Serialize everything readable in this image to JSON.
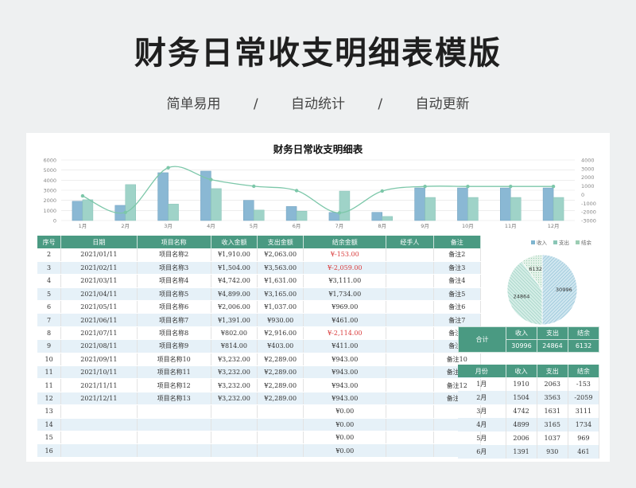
{
  "header": {
    "title": "财务日常收支明细表模版",
    "tags": [
      "简单易用",
      "/",
      "自动统计",
      "/",
      "自动更新"
    ]
  },
  "sheet_title": "财务日常收支明细表",
  "colors": {
    "primary": "#4a9a82",
    "income": "#8ab8d4",
    "expense": "#9fd3c8",
    "balance": "#7cc7a9",
    "row_alt": "#e6f1f8",
    "negative": "#d93b3b"
  },
  "chart_data": {
    "type": "bar",
    "categories": [
      "1月",
      "2月",
      "3月",
      "4月",
      "5月",
      "6月",
      "7月",
      "8月",
      "9月",
      "10月",
      "11月",
      "12月"
    ],
    "series": [
      {
        "name": "收入",
        "values": [
          1910,
          1504,
          4742,
          4899,
          2006,
          1391,
          802,
          814,
          3232,
          3232,
          3232,
          3232
        ]
      },
      {
        "name": "支出",
        "values": [
          2063,
          3563,
          1631,
          3165,
          1037,
          930,
          2916,
          403,
          2289,
          2289,
          2289,
          2289
        ]
      },
      {
        "name": "结余",
        "type": "line",
        "values": [
          -153,
          -2059,
          3111,
          1734,
          969,
          461,
          -2114,
          411,
          943,
          943,
          943,
          943
        ]
      }
    ],
    "y_left": {
      "min": 0,
      "max": 6000,
      "ticks": [
        "0",
        "1000",
        "2000",
        "3000",
        "4000",
        "5000",
        "6000"
      ]
    },
    "y_right": {
      "min": -3000,
      "max": 4000,
      "ticks": [
        "-3000",
        "-2000",
        "-1000",
        "0",
        "1000",
        "2000",
        "3000",
        "4000"
      ]
    },
    "grid": true
  },
  "table": {
    "columns": [
      "序号",
      "日期",
      "项目名称",
      "收入金额",
      "支出金额",
      "结余金额",
      "经手人",
      "备注"
    ],
    "rows": [
      [
        "2",
        "2021/01/11",
        "项目名称2",
        "¥1,910.00",
        "¥2,063.00",
        "¥-153.00",
        "",
        "备注2"
      ],
      [
        "3",
        "2021/02/11",
        "项目名称3",
        "¥1,504.00",
        "¥3,563.00",
        "¥-2,059.00",
        "",
        "备注3"
      ],
      [
        "4",
        "2021/03/11",
        "项目名称4",
        "¥4,742.00",
        "¥1,631.00",
        "¥3,111.00",
        "",
        "备注4"
      ],
      [
        "5",
        "2021/04/11",
        "项目名称5",
        "¥4,899.00",
        "¥3,165.00",
        "¥1,734.00",
        "",
        "备注5"
      ],
      [
        "6",
        "2021/05/11",
        "项目名称6",
        "¥2,006.00",
        "¥1,037.00",
        "¥969.00",
        "",
        "备注6"
      ],
      [
        "7",
        "2021/06/11",
        "项目名称7",
        "¥1,391.00",
        "¥930.00",
        "¥461.00",
        "",
        "备注7"
      ],
      [
        "8",
        "2021/07/11",
        "项目名称8",
        "¥802.00",
        "¥2,916.00",
        "¥-2,114.00",
        "",
        "备注8"
      ],
      [
        "9",
        "2021/08/11",
        "项目名称9",
        "¥814.00",
        "¥403.00",
        "¥411.00",
        "",
        "备注9"
      ],
      [
        "10",
        "2021/09/11",
        "项目名称10",
        "¥3,232.00",
        "¥2,289.00",
        "¥943.00",
        "",
        "备注10"
      ],
      [
        "11",
        "2021/10/11",
        "项目名称11",
        "¥3,232.00",
        "¥2,289.00",
        "¥943.00",
        "",
        "备注11"
      ],
      [
        "11",
        "2021/11/11",
        "项目名称12",
        "¥3,232.00",
        "¥2,289.00",
        "¥943.00",
        "",
        "备注12"
      ],
      [
        "12",
        "2021/12/11",
        "项目名称13",
        "¥3,232.00",
        "¥2,289.00",
        "¥943.00",
        "",
        "备注13"
      ],
      [
        "13",
        "",
        "",
        "",
        "",
        "¥0.00",
        "",
        ""
      ],
      [
        "14",
        "",
        "",
        "",
        "",
        "¥0.00",
        "",
        ""
      ],
      [
        "15",
        "",
        "",
        "",
        "",
        "¥0.00",
        "",
        ""
      ],
      [
        "16",
        "",
        "",
        "",
        "",
        "¥0.00",
        "",
        ""
      ]
    ]
  },
  "pie": {
    "legend": [
      "收入",
      "支出",
      "结余"
    ],
    "values": [
      30996,
      24864,
      6132
    ],
    "labels": [
      "30996",
      "24864",
      "6132"
    ]
  },
  "summary": {
    "label": "合计",
    "headers": [
      "收入",
      "支出",
      "结余"
    ],
    "values": [
      "30996",
      "24864",
      "6132"
    ]
  },
  "monthly": {
    "headers": [
      "月份",
      "收入",
      "支出",
      "结余"
    ],
    "rows": [
      [
        "1月",
        "1910",
        "2063",
        "-153"
      ],
      [
        "2月",
        "1504",
        "3563",
        "-2059"
      ],
      [
        "3月",
        "4742",
        "1631",
        "3111"
      ],
      [
        "4月",
        "4899",
        "3165",
        "1734"
      ],
      [
        "5月",
        "2006",
        "1037",
        "969"
      ],
      [
        "6月",
        "1391",
        "930",
        "461"
      ]
    ]
  }
}
